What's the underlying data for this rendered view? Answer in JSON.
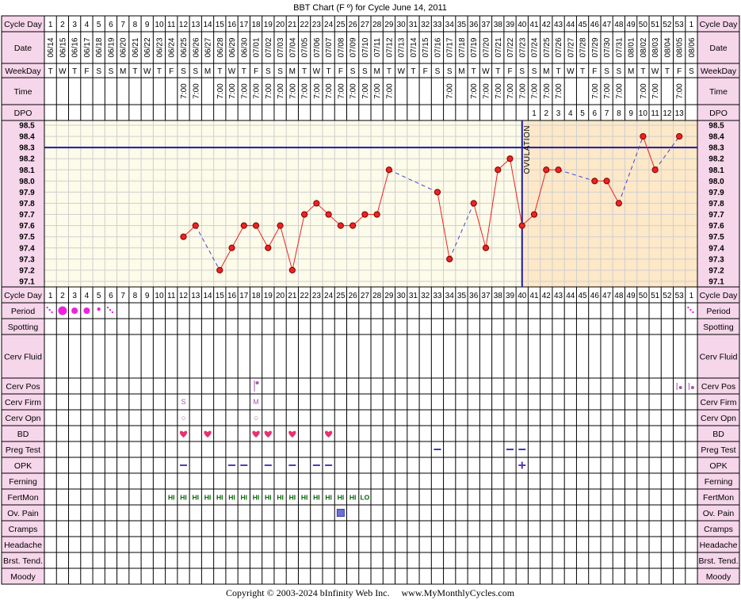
{
  "title": "BBT Chart (F º) for Cycle June 14, 2011",
  "copyright": "Copyright © 2003-2024 bInfinity Web Inc.     www.MyMonthlyCycles.com",
  "colors": {
    "label_bg": "#f6d6ea",
    "grid_bg": "#fdfbe9",
    "luteal_bg": "#fde8c8",
    "line": "#ee2222",
    "marker": "#ee2222",
    "coverline": "#1a1aa8",
    "ovulation": "#1a1aa8",
    "period": "#ee22dd",
    "heart": "#e8316f",
    "fertmon": "#006600",
    "opk": "#5c37b5",
    "preg": "#3a3ab0",
    "ovpain": "#6e6ed8",
    "cerv": "#aa55aa"
  },
  "labels": {
    "cycle_day": "Cycle Day",
    "date": "Date",
    "weekday": "WeekDay",
    "time": "Time",
    "dpo": "DPO",
    "ovulation": "OVULATION"
  },
  "row_labels": [
    "Period",
    "Spotting",
    "Cerv Fluid",
    "Cerv Pos",
    "Cerv Firm",
    "Cerv Opn",
    "BD",
    "Preg Test",
    "OPK",
    "Ferning",
    "FertMon",
    "Ov. Pain",
    "Cramps",
    "Headache",
    "Brst. Tend.",
    "Moody"
  ],
  "cycle_days": [
    "1",
    "2",
    "3",
    "4",
    "5",
    "6",
    "7",
    "8",
    "9",
    "10",
    "11",
    "12",
    "13",
    "14",
    "15",
    "16",
    "17",
    "18",
    "19",
    "20",
    "21",
    "22",
    "23",
    "24",
    "25",
    "26",
    "27",
    "28",
    "29",
    "30",
    "31",
    "32",
    "33",
    "34",
    "35",
    "36",
    "37",
    "38",
    "39",
    "40",
    "41",
    "42",
    "43",
    "44",
    "45",
    "46",
    "47",
    "48",
    "49",
    "50",
    "51",
    "52",
    "53",
    "1"
  ],
  "dates": [
    "06/14",
    "06/15",
    "06/16",
    "06/17",
    "06/18",
    "06/19",
    "06/20",
    "06/21",
    "06/22",
    "06/23",
    "06/24",
    "06/25",
    "06/26",
    "06/27",
    "06/28",
    "06/29",
    "06/30",
    "07/01",
    "07/02",
    "07/03",
    "07/04",
    "07/05",
    "07/06",
    "07/07",
    "07/08",
    "07/09",
    "07/10",
    "07/11",
    "07/12",
    "07/13",
    "07/14",
    "07/15",
    "07/16",
    "07/17",
    "07/18",
    "07/19",
    "07/20",
    "07/21",
    "07/22",
    "07/23",
    "07/24",
    "07/25",
    "07/26",
    "07/27",
    "07/28",
    "07/29",
    "07/30",
    "07/31",
    "08/01",
    "08/02",
    "08/03",
    "08/04",
    "08/05",
    "08/06"
  ],
  "weekdays": [
    "T",
    "W",
    "T",
    "F",
    "S",
    "S",
    "M",
    "T",
    "W",
    "T",
    "F",
    "S",
    "S",
    "M",
    "T",
    "W",
    "T",
    "F",
    "S",
    "S",
    "M",
    "T",
    "W",
    "T",
    "F",
    "S",
    "S",
    "M",
    "T",
    "W",
    "T",
    "F",
    "S",
    "S",
    "M",
    "T",
    "W",
    "T",
    "F",
    "S",
    "S",
    "M",
    "T",
    "W",
    "T",
    "F",
    "S",
    "S",
    "M",
    "T",
    "W",
    "T",
    "F",
    "S"
  ],
  "times": [
    "",
    "",
    "",
    "",
    "",
    "",
    "",
    "",
    "",
    "",
    "",
    "7:00",
    "7:00",
    "",
    "7:00",
    "7:00",
    "7:00",
    "7:00",
    "7:00",
    "7:00",
    "7:00",
    "7:00",
    "7:00",
    "7:00",
    "7:00",
    "7:00",
    "7:00",
    "7:00",
    "7:00",
    "",
    "",
    "",
    "",
    "7:00",
    "",
    "7:00",
    "7:00",
    "7:00",
    "7:00",
    "7:00",
    "7:00",
    "7:00",
    "7:00",
    "",
    "",
    "7:00",
    "7:00",
    "7:00",
    "",
    "7:00",
    "7:00",
    "",
    "7:00",
    ""
  ],
  "dpo": [
    "",
    "",
    "",
    "",
    "",
    "",
    "",
    "",
    "",
    "",
    "",
    "",
    "",
    "",
    "",
    "",
    "",
    "",
    "",
    "",
    "",
    "",
    "",
    "",
    "",
    "",
    "",
    "",
    "",
    "",
    "",
    "",
    "",
    "",
    "",
    "",
    "",
    "",
    "",
    "",
    "1",
    "2",
    "3",
    "4",
    "5",
    "6",
    "7",
    "8",
    "9",
    "10",
    "11",
    "12",
    "13",
    ""
  ],
  "chart_data": {
    "type": "line",
    "title": "BBT Chart (F º) for Cycle June 14, 2011",
    "xlabel": "Cycle Day",
    "ylabel": "",
    "ylim": [
      97.1,
      98.5
    ],
    "y_ticks": [
      "98.5",
      "98.4",
      "98.3",
      "98.2",
      "98.1",
      "98.0",
      "97.9",
      "97.8",
      "97.7",
      "97.6",
      "97.5",
      "97.4",
      "97.3",
      "97.2",
      "97.1"
    ],
    "grid": true,
    "coverline": 98.3,
    "ovulation_day": 40,
    "temps": [
      {
        "day": 12,
        "temp": 97.5
      },
      {
        "day": 13,
        "temp": 97.6
      },
      {
        "day": 15,
        "temp": 97.2
      },
      {
        "day": 16,
        "temp": 97.4
      },
      {
        "day": 17,
        "temp": 97.6
      },
      {
        "day": 18,
        "temp": 97.6
      },
      {
        "day": 19,
        "temp": 97.4
      },
      {
        "day": 20,
        "temp": 97.6
      },
      {
        "day": 21,
        "temp": 97.2
      },
      {
        "day": 22,
        "temp": 97.7
      },
      {
        "day": 23,
        "temp": 97.8
      },
      {
        "day": 24,
        "temp": 97.7
      },
      {
        "day": 25,
        "temp": 97.6
      },
      {
        "day": 26,
        "temp": 97.6
      },
      {
        "day": 27,
        "temp": 97.7
      },
      {
        "day": 28,
        "temp": 97.7
      },
      {
        "day": 29,
        "temp": 98.1
      },
      {
        "day": 33,
        "temp": 97.9
      },
      {
        "day": 34,
        "temp": 97.3
      },
      {
        "day": 36,
        "temp": 97.8
      },
      {
        "day": 37,
        "temp": 97.4
      },
      {
        "day": 38,
        "temp": 98.1
      },
      {
        "day": 39,
        "temp": 98.2
      },
      {
        "day": 40,
        "temp": 97.6
      },
      {
        "day": 41,
        "temp": 97.7
      },
      {
        "day": 42,
        "temp": 98.1
      },
      {
        "day": 43,
        "temp": 98.1
      },
      {
        "day": 46,
        "temp": 98.0
      },
      {
        "day": 47,
        "temp": 98.0
      },
      {
        "day": 48,
        "temp": 97.8
      },
      {
        "day": 50,
        "temp": 98.4
      },
      {
        "day": 51,
        "temp": 98.1
      },
      {
        "day": 53,
        "temp": 98.4
      }
    ]
  },
  "observations": {
    "period": [
      {
        "day": 1,
        "kind": "spot"
      },
      {
        "day": 2,
        "kind": "heavy"
      },
      {
        "day": 3,
        "kind": "medium"
      },
      {
        "day": 4,
        "kind": "medium"
      },
      {
        "day": 5,
        "kind": "light"
      },
      {
        "day": 6,
        "kind": "spot"
      },
      {
        "day": 54,
        "kind": "spot"
      }
    ],
    "cerv_pos": [
      {
        "day": 18,
        "kind": "high"
      },
      {
        "day": 53,
        "kind": "low"
      },
      {
        "day": 54,
        "kind": "low"
      }
    ],
    "cerv_firm": [
      {
        "day": 12,
        "text": "S"
      },
      {
        "day": 18,
        "text": "M"
      }
    ],
    "cerv_opn": [
      {
        "day": 12,
        "text": "○"
      },
      {
        "day": 18,
        "text": "○"
      }
    ],
    "bd": [
      12,
      14,
      18,
      19,
      21,
      24
    ],
    "preg_test": [
      33,
      39,
      40
    ],
    "opk": [
      {
        "day": 12,
        "text": "−"
      },
      {
        "day": 16,
        "text": "−"
      },
      {
        "day": 17,
        "text": "−"
      },
      {
        "day": 19,
        "text": "−"
      },
      {
        "day": 21,
        "text": "−"
      },
      {
        "day": 23,
        "text": "−"
      },
      {
        "day": 24,
        "text": "−"
      },
      {
        "day": 40,
        "text": "+"
      }
    ],
    "fertmon": [
      {
        "day": 11,
        "text": "HI"
      },
      {
        "day": 12,
        "text": "HI"
      },
      {
        "day": 13,
        "text": "HI"
      },
      {
        "day": 14,
        "text": "HI"
      },
      {
        "day": 15,
        "text": "HI"
      },
      {
        "day": 16,
        "text": "HI"
      },
      {
        "day": 17,
        "text": "HI"
      },
      {
        "day": 18,
        "text": "HI"
      },
      {
        "day": 19,
        "text": "HI"
      },
      {
        "day": 20,
        "text": "HI"
      },
      {
        "day": 21,
        "text": "HI"
      },
      {
        "day": 22,
        "text": "HI"
      },
      {
        "day": 23,
        "text": "HI"
      },
      {
        "day": 24,
        "text": "HI"
      },
      {
        "day": 25,
        "text": "HI"
      },
      {
        "day": 26,
        "text": "HI"
      },
      {
        "day": 27,
        "text": "LO"
      }
    ],
    "ov_pain": [
      25
    ]
  }
}
